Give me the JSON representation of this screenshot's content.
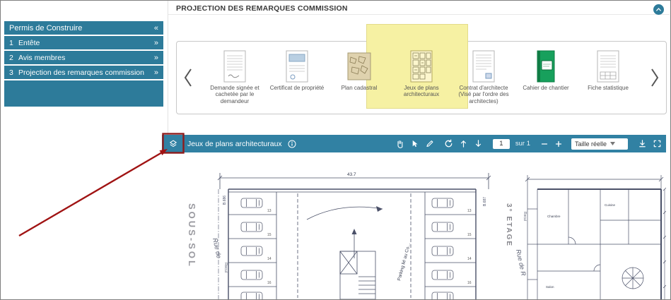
{
  "sidebar": {
    "title": "Permis de Construire",
    "collapse_icon": "«",
    "expand_icon": "»",
    "items": [
      {
        "num": "1",
        "label": "Entête"
      },
      {
        "num": "2",
        "label": "Avis membres"
      },
      {
        "num": "3",
        "label": "Projection des remarques commission"
      }
    ]
  },
  "header": {
    "title": "PROJECTION DES REMARQUES COMMISSION"
  },
  "carousel": {
    "items": [
      {
        "label": "Demande signée et cachetée par le demandeur"
      },
      {
        "label": "Certificat de propriété"
      },
      {
        "label": "Plan cadastral"
      },
      {
        "label": "Jeux de plans architecturaux",
        "selected": true
      },
      {
        "label": "Contrat d'architecte (Visé par l'ordre des architectes)"
      },
      {
        "label": "Cahier de chantier"
      },
      {
        "label": "Fiche statistique"
      }
    ]
  },
  "viewer": {
    "title": "Jeux de plans architecturaux",
    "page": "1",
    "page_suffix": "sur 1",
    "zoom": "Taille réelle",
    "tool_icons": [
      "layers",
      "info",
      "pan-hand",
      "text-select",
      "annotate-marker",
      "rotate",
      "page-up",
      "page-down",
      "zoom-out",
      "zoom-in",
      "download",
      "fullscreen"
    ]
  },
  "plan": {
    "sous_sol": "SOUS-SOL",
    "etage": "3° ETAGE",
    "rue_left": "Rue de",
    "rue_right": "Rue de R",
    "recul_left": "Recul",
    "recul_right": "Recul",
    "parking_label": "Parking lié au Co...",
    "b686": "B.686",
    "b687": "B.687",
    "dim_top": "43.7",
    "stall_numbers_left": [
      "13",
      "15",
      "14",
      "16"
    ],
    "stall_numbers_right": [
      "13",
      "15",
      "14",
      "16"
    ],
    "rooms": [
      "Chambre",
      "Salon",
      "Cuisine"
    ]
  },
  "colors": {
    "sidebar_teal": "#2d7b9a",
    "toolbar_teal": "#3181a3",
    "selection_yellow": "#f6f1a3",
    "annotation_red": "#8e1b1b",
    "layers_green": "#3fa045"
  }
}
